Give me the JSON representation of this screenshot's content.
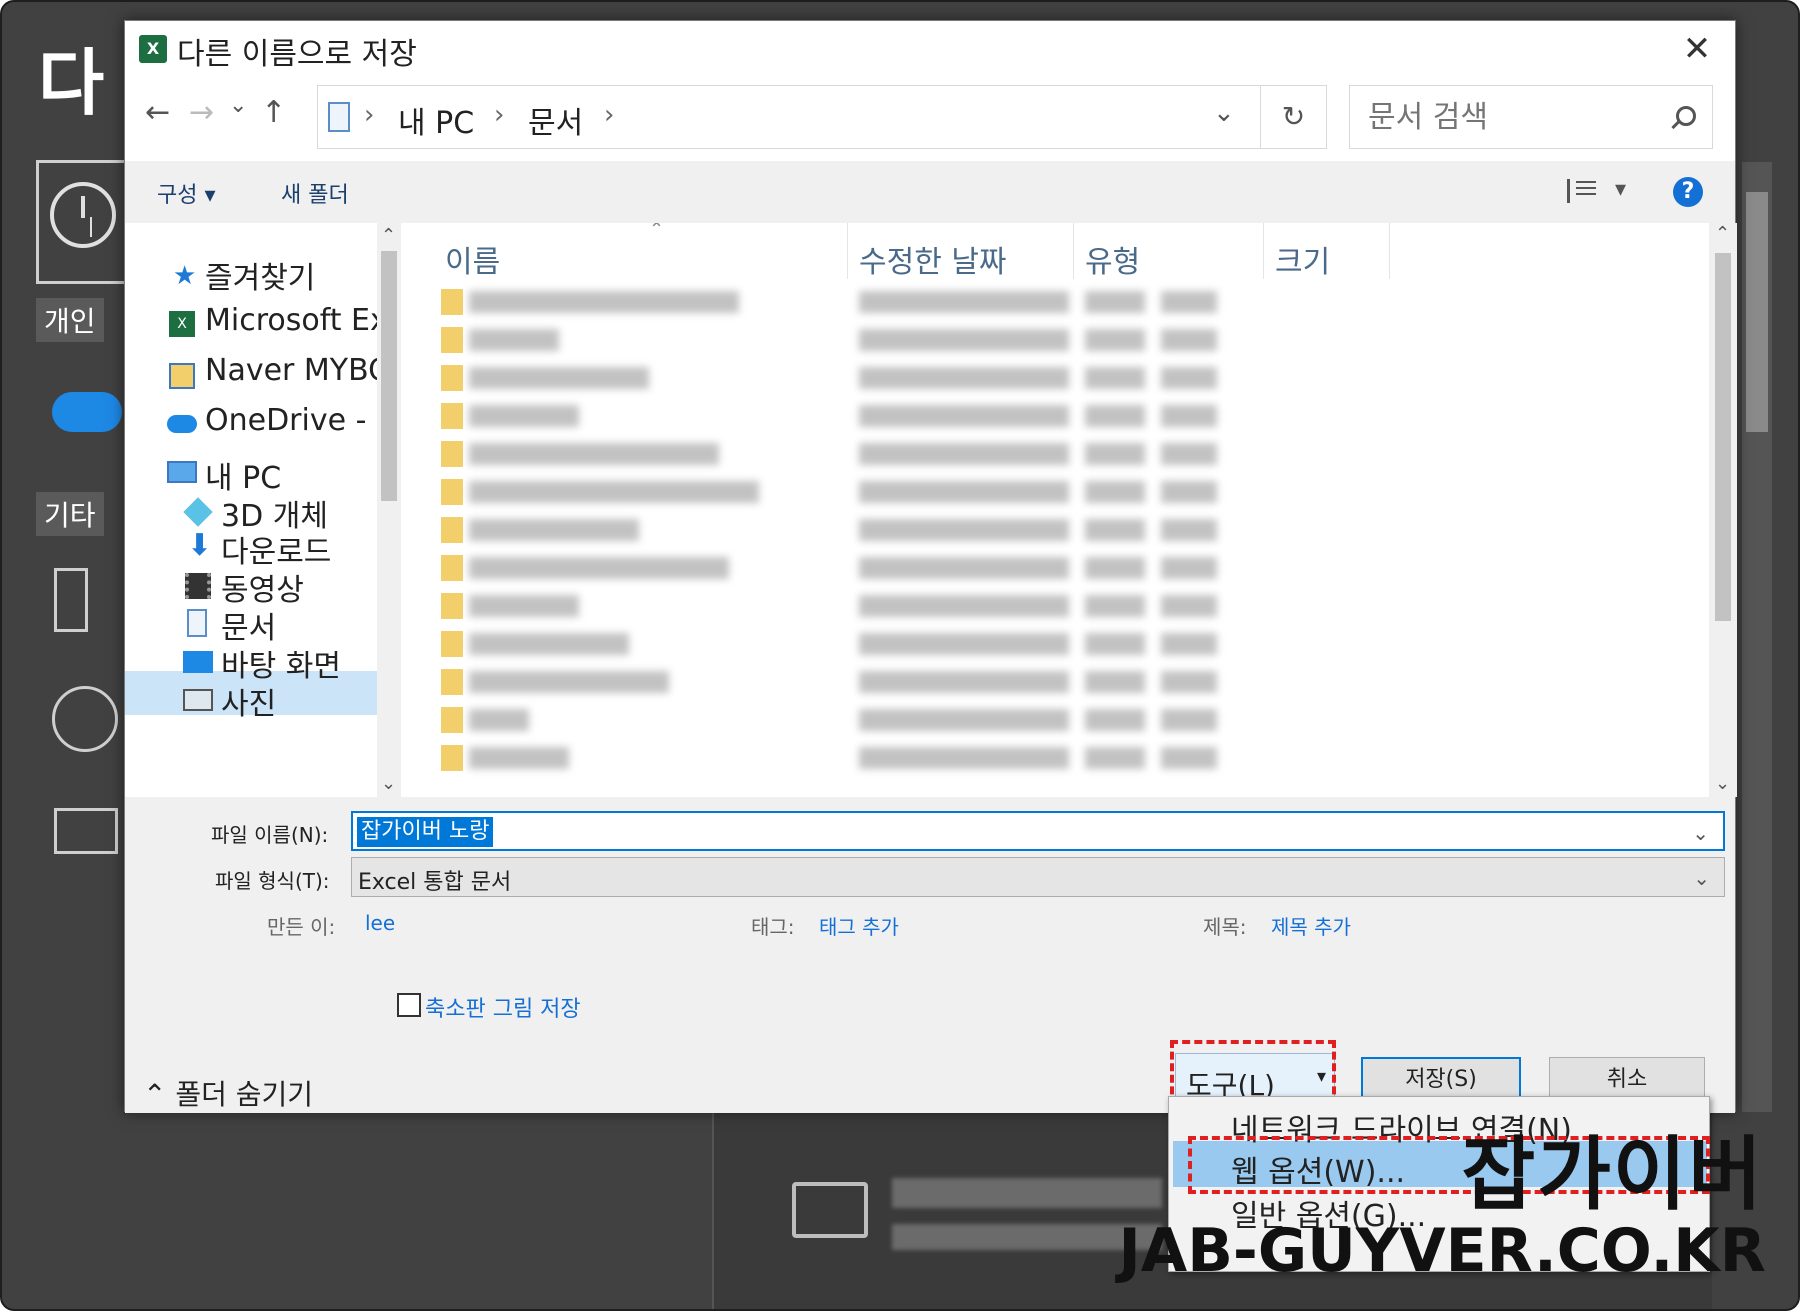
{
  "dialog": {
    "title": "다른 이름으로 저장",
    "close_symbol": "✕"
  },
  "backstage": {
    "title_partial": "다",
    "personal_label": "개인",
    "other_label": "기타"
  },
  "navbar": {
    "back_symbol": "←",
    "forward_symbol": "→",
    "dropdown_symbol": "⌄",
    "up_symbol": "↑",
    "breadcrumbs": [
      "내 PC",
      "문서"
    ],
    "crumb_sep": "›",
    "addr_dropdown": "⌄",
    "refresh_symbol": "↻",
    "search_placeholder": "문서 검색"
  },
  "toolbar": {
    "organize_label": "구성 ▾",
    "new_folder_label": "새 폴더",
    "view_caret": "▾",
    "help_label": "?"
  },
  "nav_pane": {
    "items": [
      {
        "label": "즐겨찾기",
        "icon": "star-icon"
      },
      {
        "label": "Microsoft Ex",
        "icon": "excel-icon"
      },
      {
        "label": "Naver MYBO",
        "icon": "naver-box-icon"
      },
      {
        "label": "OneDrive - P",
        "icon": "onedrive-icon"
      },
      {
        "label": "내 PC",
        "icon": "computer-icon"
      },
      {
        "label": "3D 개체",
        "icon": "cube-icon"
      },
      {
        "label": "다운로드",
        "icon": "download-icon"
      },
      {
        "label": "동영상",
        "icon": "video-icon"
      },
      {
        "label": "문서",
        "icon": "document-icon"
      },
      {
        "label": "바탕 화면",
        "icon": "desktop-icon"
      },
      {
        "label": "사진",
        "icon": "picture-icon"
      }
    ],
    "scroll_up": "⌃",
    "scroll_down": "⌄"
  },
  "file_list": {
    "columns": [
      "이름",
      "수정한 날짜",
      "유형",
      "크기"
    ],
    "sort_indicator": "⌃",
    "row_count": 13
  },
  "form": {
    "filename_label": "파일 이름(N):",
    "filename_value": "잡가이버 노랑",
    "filetype_label": "파일 형식(T):",
    "filetype_value": "Excel 통합 문서",
    "chevron": "⌄",
    "author_label": "만든 이:",
    "author_value": "lee",
    "tags_label": "태그:",
    "tags_value": "태그 추가",
    "title_label": "제목:",
    "title_value": "제목 추가",
    "thumbnail_label": "축소판 그림 저장",
    "hide_folders_label": "⌃  폴더 숨기기",
    "tools_label": "도구(L)",
    "tools_caret": "▾",
    "save_label": "저장(S)",
    "cancel_label": "취소"
  },
  "menu": {
    "items": [
      "네트워크 드라이브 연결(N)...",
      "웹 옵션(W)...",
      "일반 옵션(G)..."
    ],
    "highlighted_index": 1
  },
  "watermark": {
    "title": "잡가이버",
    "url": "JAB-GUYVER.CO.KR"
  },
  "colors": {
    "accent": "#0078d7",
    "highlight_box": "#e02020",
    "selected_nav": "#cce4f7",
    "menu_highlight": "#99c9ef"
  }
}
